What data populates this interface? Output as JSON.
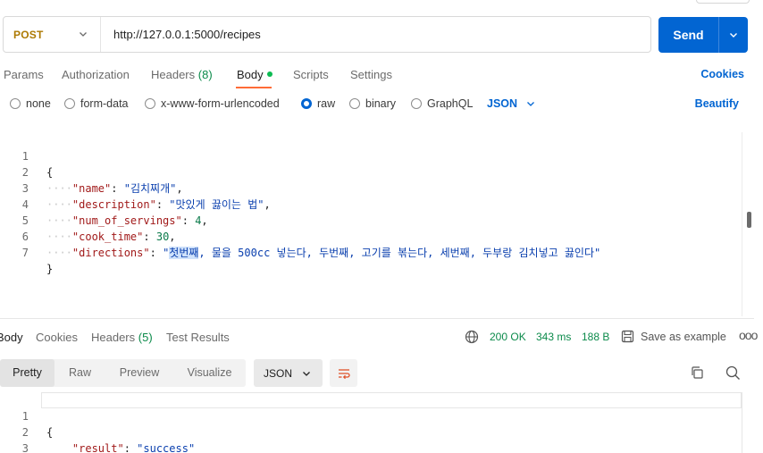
{
  "request": {
    "method": "POST",
    "url": "http://127.0.0.1:5000/recipes",
    "send_label": "Send"
  },
  "request_tabs": [
    {
      "label": "Params"
    },
    {
      "label": "Authorization"
    },
    {
      "label": "Headers",
      "count": "(8)"
    },
    {
      "label": "Body",
      "active": true
    },
    {
      "label": "Scripts"
    },
    {
      "label": "Settings"
    }
  ],
  "cookies_label": "Cookies",
  "body_types": [
    "none",
    "form-data",
    "x-www-form-urlencoded",
    "raw",
    "binary",
    "GraphQL"
  ],
  "body_type_selected": "raw",
  "body_format": "JSON",
  "beautify_label": "Beautify",
  "request_body": {
    "line_numbers": [
      "1",
      "2",
      "3",
      "4",
      "5",
      "6",
      "7"
    ],
    "open": "{",
    "close": "}",
    "indent": "····",
    "fields": [
      {
        "key": "\"name\"",
        "value": "\"김치찌개\"",
        "type": "string"
      },
      {
        "key": "\"description\"",
        "value": "\"맛있게 끓이는 법\"",
        "type": "string"
      },
      {
        "key": "\"num_of_servings\"",
        "value": "4",
        "type": "number"
      },
      {
        "key": "\"cook_time\"",
        "value": "30",
        "type": "number"
      },
      {
        "key": "\"directions\"",
        "value_quote": "\"",
        "value_selected": "첫번째",
        "value_rest": ", 물을 500cc 넣는다, 두번째, 고기를 볶는다, 세번째, 두부랑 김치넣고 끓인다\"",
        "type": "string"
      }
    ]
  },
  "response_tabs": [
    {
      "label": "Body",
      "active": true
    },
    {
      "label": "Cookies"
    },
    {
      "label": "Headers",
      "count": "(5)"
    },
    {
      "label": "Test Results"
    }
  ],
  "response_status": {
    "code": "200 OK",
    "time": "343 ms",
    "size": "188 B"
  },
  "save_example_label": "Save as example",
  "more_label": "ooo",
  "response_views": [
    "Pretty",
    "Raw",
    "Preview",
    "Visualize"
  ],
  "response_view_active": "Pretty",
  "response_format": "JSON",
  "response_body": {
    "line_numbers": [
      "1",
      "2",
      "3"
    ],
    "open": "{",
    "close": "}",
    "key": "\"result\"",
    "value": "\"success\""
  },
  "colors": {
    "accent": "#0265d2",
    "method": "#ad7a03",
    "tab_indicator": "#ff6c37",
    "status_ok": "#0b8a4a"
  }
}
